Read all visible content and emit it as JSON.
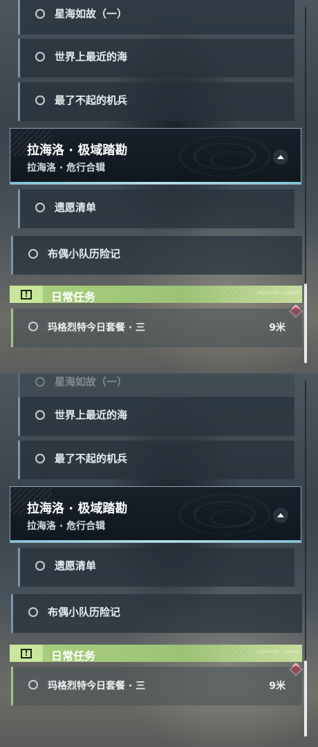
{
  "quests": {
    "q1": "星海如故（一）",
    "q2": "世界上最近的海",
    "q3": "最了不起的机兵",
    "q4": "遗愿清单",
    "q5": "布偶小队历险记"
  },
  "chapter": {
    "title": "拉海洛 · 极域踏勘",
    "subtitle": "拉海洛 · 危行合辑"
  },
  "daily": {
    "header": "日常任务",
    "badge": "!",
    "tag": "ПОДРОБНЕЕ · ЗАДАНИЯ",
    "item": "玛格烈特今日套餐 · 三",
    "distance": "9米"
  },
  "colors": {
    "accent_green": "#a9d07d",
    "marker_red": "#e0485a",
    "chapter_border": "#8fa6b6"
  }
}
